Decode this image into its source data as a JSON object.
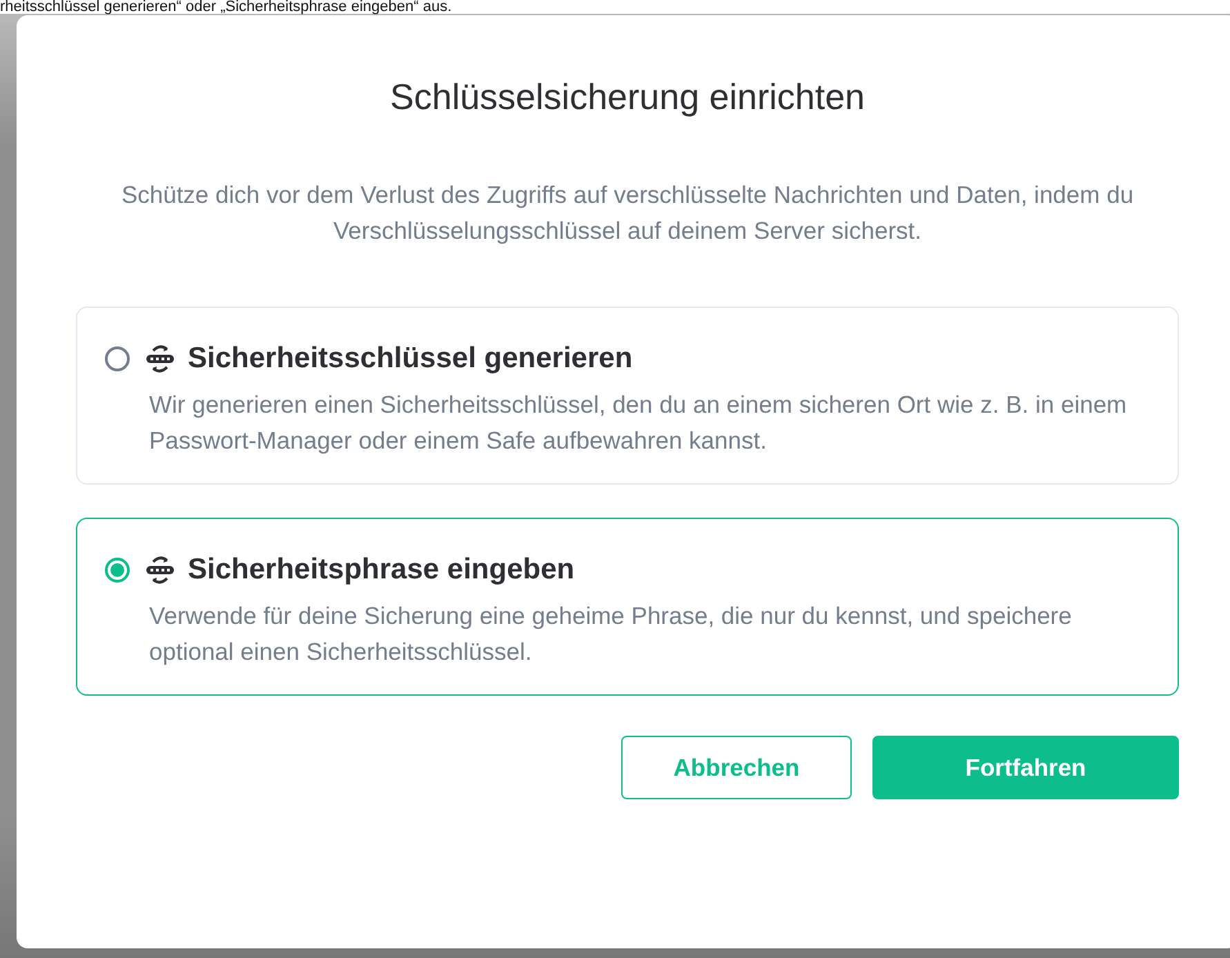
{
  "background_text": "rheitsschlüssel generieren“ oder „Sicherheitsphrase eingeben“ aus.",
  "dialog": {
    "title": "Schlüsselsicherung einrichten",
    "description": "Schütze dich vor dem Verlust des Zugriffs auf verschlüsselte Nachrichten und Daten, indem du Verschlüsselungsschlüssel auf deinem Server sicherst.",
    "options": [
      {
        "label": "Sicherheitsschlüssel generieren",
        "description": "Wir generieren einen Sicherheitsschlüssel, den du an einem sicheren Ort wie z. B. in einem Passwort-Manager oder einem Safe aufbewahren kannst.",
        "selected": false
      },
      {
        "label": "Sicherheitsphrase eingeben",
        "description": "Verwende für deine Sicherung eine geheime Phrase, die nur du kennst, und speichere optional einen Sicherheitsschlüssel.",
        "selected": true
      }
    ],
    "buttons": [
      {
        "label": "Abbrechen",
        "kind": "secondary"
      },
      {
        "label": "Fortfahren",
        "kind": "primary"
      }
    ]
  }
}
